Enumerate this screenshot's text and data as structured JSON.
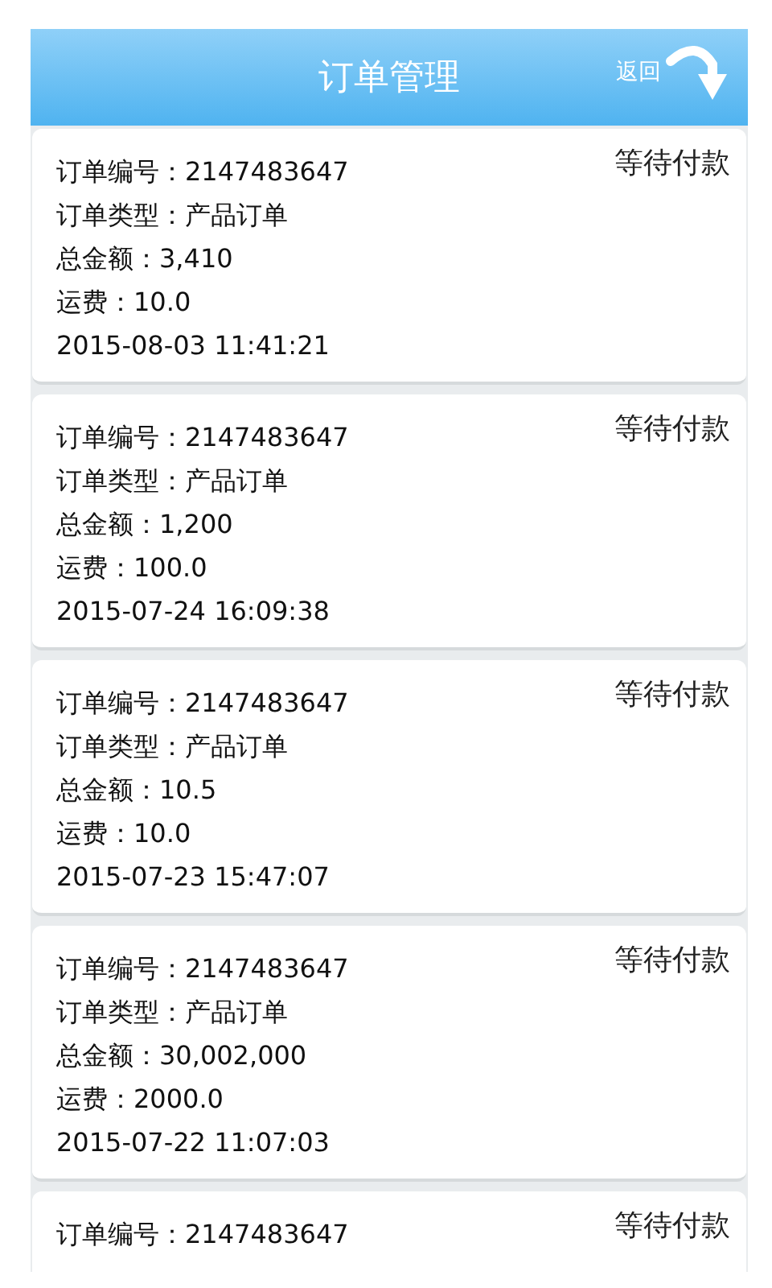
{
  "header": {
    "title": "订单管理",
    "back": "返回"
  },
  "orders": [
    {
      "lines": [
        "订单编号：2147483647",
        "订单类型：产品订单",
        "总金额：3,410",
        "运费：10.0",
        "2015-08-03 11:41:21"
      ],
      "status": "等待付款"
    },
    {
      "lines": [
        "订单编号：2147483647",
        "订单类型：产品订单",
        "总金额：1,200",
        "运费：100.0",
        "2015-07-24 16:09:38"
      ],
      "status": "等待付款"
    },
    {
      "lines": [
        "订单编号：2147483647",
        "订单类型：产品订单",
        "总金额：10.5",
        "运费：10.0",
        "2015-07-23 15:47:07"
      ],
      "status": "等待付款"
    },
    {
      "lines": [
        "订单编号：2147483647",
        "订单类型：产品订单",
        "总金额：30,002,000",
        "运费：2000.0",
        "2015-07-22 11:07:03"
      ],
      "status": "等待付款"
    },
    {
      "lines": [
        "订单编号：2147483647"
      ],
      "status": "等待付款"
    }
  ]
}
